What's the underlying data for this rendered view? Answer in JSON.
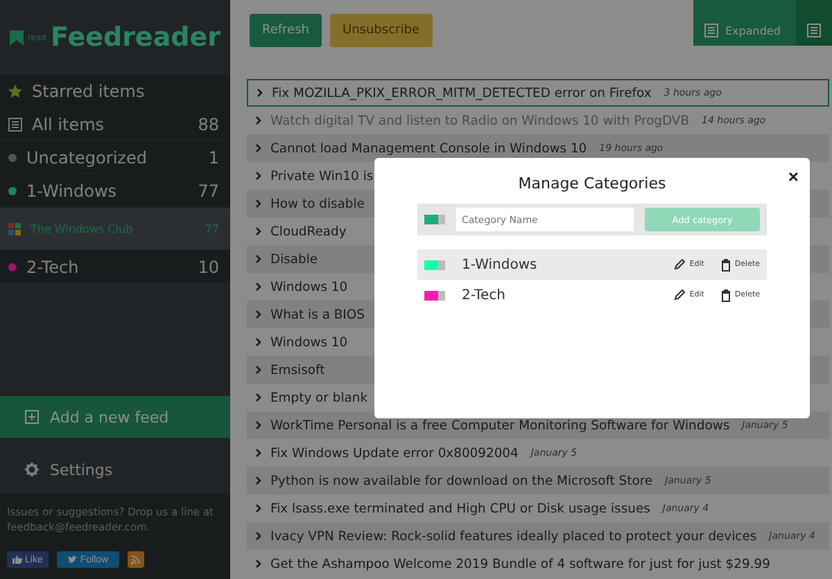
{
  "logo": {
    "small": "read",
    "name": "Feedreader"
  },
  "sidebar": {
    "items": [
      {
        "kind": "starred",
        "label": "Starred items",
        "selected": false
      },
      {
        "kind": "all",
        "label": "All items",
        "count": "88",
        "selected": false
      },
      {
        "kind": "category",
        "label": "Uncategorized",
        "count": "1",
        "color": "#555555",
        "selected": false
      },
      {
        "kind": "category",
        "label": "1-Windows",
        "count": "77",
        "color": "#17865a",
        "selected": false,
        "children": [
          {
            "label": "The Windows Club",
            "count": "77",
            "selected": true
          }
        ]
      },
      {
        "kind": "category",
        "label": "2-Tech",
        "count": "10",
        "color": "#9c1470",
        "selected": false
      }
    ],
    "add_feed": "Add a new feed",
    "settings": "Settings",
    "footer": {
      "text": "Issues or suggestions? Drop us a line at",
      "link": "feedback@feedreader.com",
      "after": "."
    },
    "social": [
      {
        "kind": "like",
        "label": "Like"
      },
      {
        "kind": "follow",
        "label": "Follow"
      },
      {
        "kind": "rss"
      }
    ]
  },
  "toolbar": {
    "buttons": [
      {
        "kind": "primary",
        "label": "Refresh"
      },
      {
        "kind": "warning",
        "label": "Unsubscribe"
      }
    ],
    "views": [
      {
        "label": "Expanded",
        "selected": true
      },
      {
        "selected": false
      }
    ]
  },
  "articles": [
    {
      "title": "Fix MOZILLA_PKIX_ERROR_MITM_DETECTED error on Firefox",
      "time": "3 hours ago",
      "selected": true,
      "read": false
    },
    {
      "title": "Watch digital TV and listen to Radio on Windows 10 with ProgDVB",
      "time": "14 hours ago",
      "selected": false,
      "read": true
    },
    {
      "title": "Cannot load Management Console in Windows 10",
      "time": "19 hours ago",
      "selected": false,
      "read": false
    },
    {
      "title": "Private Win10 is",
      "selected": false,
      "read": false
    },
    {
      "title": "How to disable",
      "selected": false,
      "read": false
    },
    {
      "title": "CloudReady",
      "selected": false,
      "read": false
    },
    {
      "title": "Disable",
      "selected": false,
      "read": false
    },
    {
      "title": "Windows 10",
      "selected": false,
      "read": false
    },
    {
      "title": "What is a BIOS",
      "selected": false,
      "read": false
    },
    {
      "title": "Windows 10",
      "selected": false,
      "read": false
    },
    {
      "title": "Emsisoft",
      "selected": false,
      "read": false
    },
    {
      "title": "Empty or blank",
      "selected": false,
      "read": false
    },
    {
      "title": "WorkTime Personal is a free Computer Monitoring Software for Windows",
      "time": "January 5",
      "selected": false,
      "read": false
    },
    {
      "title": "Fix Windows Update error 0x80092004",
      "time": "January 5",
      "selected": false,
      "read": false
    },
    {
      "title": "Python is now available for download on the Microsoft Store",
      "time": "January 5",
      "selected": false,
      "read": false
    },
    {
      "title": "Fix lsass.exe terminated and High CPU or Disk usage issues",
      "time": "January 4",
      "selected": false,
      "read": false
    },
    {
      "title": "Ivacy VPN Review: Rock-solid features ideally placed to protect your devices",
      "time": "January 4",
      "selected": false,
      "read": false
    },
    {
      "title": "Get the Ashampoo Welcome 2019 Bundle of 4 software for just for just $29.99",
      "selected": false,
      "read": false
    }
  ],
  "modal": {
    "title": "Manage Categories",
    "close": "×",
    "new_category": {
      "color": "#1fae74"
    },
    "placeholder": "Category Name",
    "add_button": "Add category",
    "categories": [
      {
        "name": "1-Windows",
        "color": "#1affa6",
        "selected": true,
        "edit": "Edit",
        "delete": "Delete"
      },
      {
        "name": "2-Tech",
        "color": "#ff1aaf",
        "selected": false,
        "edit": "Edit",
        "delete": "Delete"
      }
    ]
  }
}
